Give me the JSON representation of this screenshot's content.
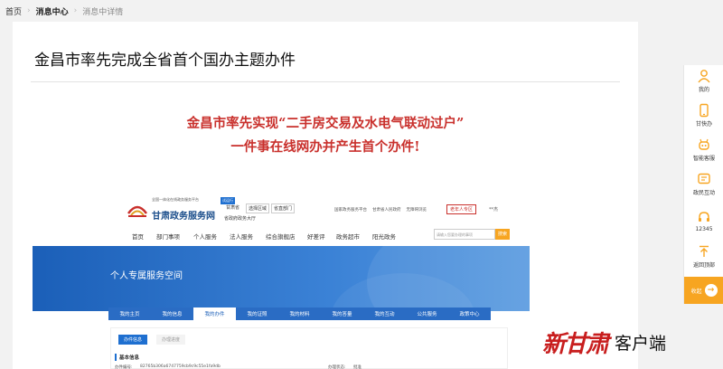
{
  "breadcrumb": {
    "home": "首页",
    "center": "消息中心",
    "detail": "消息中详情"
  },
  "article": {
    "title": "金昌市率先完成全省首个国办主题办件",
    "headline_line1": "金昌市率先实现“二手房交易及水电气联动过户”",
    "headline_line2": "一件事在线网办并产生首个办件!"
  },
  "screenshot": {
    "site_sub": "全国一体化在线政务服务平台",
    "site_name": "甘肃政务服务网",
    "tag": "试运行",
    "province": "甘肃省",
    "region_select": "选择区域",
    "dept_select": "省直部门",
    "hall": "省政府政务大厅",
    "top_links": [
      "国家政务服务平台",
      "甘肃省人民政府",
      "无障碍浏览"
    ],
    "elder_mode": "老年人专区",
    "user": "**杰",
    "nav": [
      "首页",
      "部门事项",
      "个人服务",
      "法人服务",
      "综合旗舰店",
      "好差评",
      "政务超市",
      "阳光政务"
    ],
    "search_placeholder": "请输入您要办理的事项",
    "search_button": "搜索",
    "banner_title": "个人专属服务空间",
    "tabs": [
      "我的主页",
      "我的信息",
      "我的办件",
      "我的证照",
      "我的材料",
      "我的答量",
      "我的互动",
      "公共服务",
      "政策中心"
    ],
    "active_tab": "我的办件",
    "subtab_active": "办件信息",
    "subtab_other": "办理进度",
    "basic_info": "基本信息",
    "row_label1": "办件编号:",
    "row_value1": "82765b306a6747759cb9c9c55e1fa9db",
    "row_label2": "办理状态:",
    "row_value2": "批准"
  },
  "sidebar": {
    "items": [
      {
        "label": "我的",
        "icon": "user-icon"
      },
      {
        "label": "甘快办",
        "icon": "phone-icon"
      },
      {
        "label": "智能客服",
        "icon": "robot-icon"
      },
      {
        "label": "政民互动",
        "icon": "chat-icon"
      },
      {
        "label": "12345",
        "icon": "headset-icon"
      },
      {
        "label": "返回顶部",
        "icon": "arrow-up-icon"
      }
    ],
    "collapse_label": "收起"
  },
  "watermark": {
    "brand": "新甘肃",
    "suffix": "客户端"
  },
  "colors": {
    "accent": "#f7a521",
    "headline": "#c9302c",
    "banner": "#1b5fb8"
  }
}
